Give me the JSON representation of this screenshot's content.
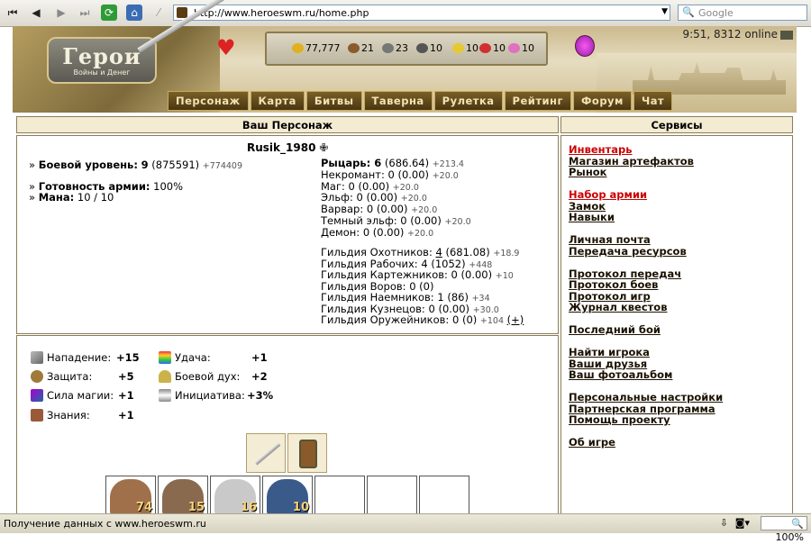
{
  "browser": {
    "url": "http://www.heroeswm.ru/home.php",
    "search_placeholder": "Google",
    "status": "Получение данных с www.heroeswm.ru",
    "zoom": "100%"
  },
  "header": {
    "logo_title": "Герои",
    "logo_subtitle": "Войны и Денег",
    "online": "9:51, 8312 online",
    "resources": [
      {
        "name": "gold-icon",
        "value": "77,777",
        "color": "#e0b020"
      },
      {
        "name": "wood-icon",
        "value": "21",
        "color": "#8b5a2b"
      },
      {
        "name": "ore-icon",
        "value": "23",
        "color": "#777777"
      },
      {
        "name": "mercury-icon",
        "value": "10",
        "color": "#555555"
      },
      {
        "name": "sulfur-icon",
        "value": "10",
        "color": "#e6c830"
      },
      {
        "name": "crystal-icon",
        "value": "10",
        "color": "#d03030"
      },
      {
        "name": "gems-icon",
        "value": "10",
        "color": "#e070c0"
      }
    ],
    "nav": [
      "Персонаж",
      "Карта",
      "Битвы",
      "Таверна",
      "Рулетка",
      "Рейтинг",
      "Форум",
      "Чат"
    ]
  },
  "character": {
    "panel_title": "Ваш Персонаж",
    "name": "Rusik_1980",
    "combat_level_label": "Боевой уровень:",
    "combat_level": "9",
    "combat_level_exp": "(875591)",
    "combat_level_next": "+774409",
    "army_label": "Готовность армии:",
    "army_value": "100%",
    "mana_label": "Мана:",
    "mana_value": "10 / 10",
    "factions": [
      {
        "label": "Рыцарь: 6",
        "value": "(686.64)",
        "delta": "+213.4",
        "bold": true
      },
      {
        "label": "Некромант: 0",
        "value": "(0.00)",
        "delta": "+20.0"
      },
      {
        "label": "Маг: 0",
        "value": "(0.00)",
        "delta": "+20.0"
      },
      {
        "label": "Эльф: 0",
        "value": "(0.00)",
        "delta": "+20.0"
      },
      {
        "label": "Варвар: 0",
        "value": "(0.00)",
        "delta": "+20.0"
      },
      {
        "label": "Темный эльф: 0",
        "value": "(0.00)",
        "delta": "+20.0"
      },
      {
        "label": "Демон: 0",
        "value": "(0.00)",
        "delta": "+20.0"
      }
    ],
    "guilds": [
      {
        "label": "Гильдия Охотников:",
        "level": "4",
        "value": "(681.08)",
        "delta": "+18.9"
      },
      {
        "label": "Гильдия Рабочих:",
        "level": "4",
        "value": "(1052)",
        "delta": "+448"
      },
      {
        "label": "Гильдия Картежников:",
        "level": "0",
        "value": "(0.00)",
        "delta": "+10"
      },
      {
        "label": "Гильдия Воров:",
        "level": "0",
        "value": "(0)",
        "delta": ""
      },
      {
        "label": "Гильдия Наемников:",
        "level": "1",
        "value": "(86)",
        "delta": "+34"
      },
      {
        "label": "Гильдия Кузнецов:",
        "level": "0",
        "value": "(0.00)",
        "delta": "+30.0"
      },
      {
        "label": "Гильдия Оружейников:",
        "level": "0",
        "value": "(0)",
        "delta": "+104",
        "extra": "(+)"
      }
    ]
  },
  "stats": {
    "attack": {
      "label": "Нападение:",
      "value": "+15"
    },
    "defense": {
      "label": "Защита:",
      "value": "+5"
    },
    "spellpower": {
      "label": "Сила магии:",
      "value": "+1"
    },
    "knowledge": {
      "label": "Знания:",
      "value": "+1"
    },
    "luck": {
      "label": "Удача:",
      "value": "+1"
    },
    "morale": {
      "label": "Боевой дух:",
      "value": "+2"
    },
    "initiative": {
      "label": "Инициатива:",
      "value": "+3%"
    }
  },
  "army": [
    {
      "count": "74",
      "color": "#a0704a"
    },
    {
      "count": "15",
      "color": "#8a6a4e"
    },
    {
      "count": "16",
      "color": "#c9c9c9"
    },
    {
      "count": "10",
      "color": "#3a5a8a"
    }
  ],
  "services": {
    "panel_title": "Сервисы",
    "groups": [
      [
        "Инвентарь",
        "Магазин артефактов",
        "Рынок"
      ],
      [
        "Набор армии",
        "Замок",
        "Навыки"
      ],
      [
        "Личная почта",
        "Передача ресурсов"
      ],
      [
        "Протокол передач",
        "Протокол боев",
        "Протокол игр",
        "Журнал квестов"
      ],
      [
        "Последний бой"
      ],
      [
        "Найти игрока",
        "Ваши друзья",
        "Ваш фотоальбом"
      ],
      [
        "Персональные настройки",
        "Партнерская программа",
        "Помощь проекту"
      ],
      [
        "Об игре"
      ]
    ],
    "red_items": [
      "Инвентарь",
      "Набор армии"
    ]
  }
}
